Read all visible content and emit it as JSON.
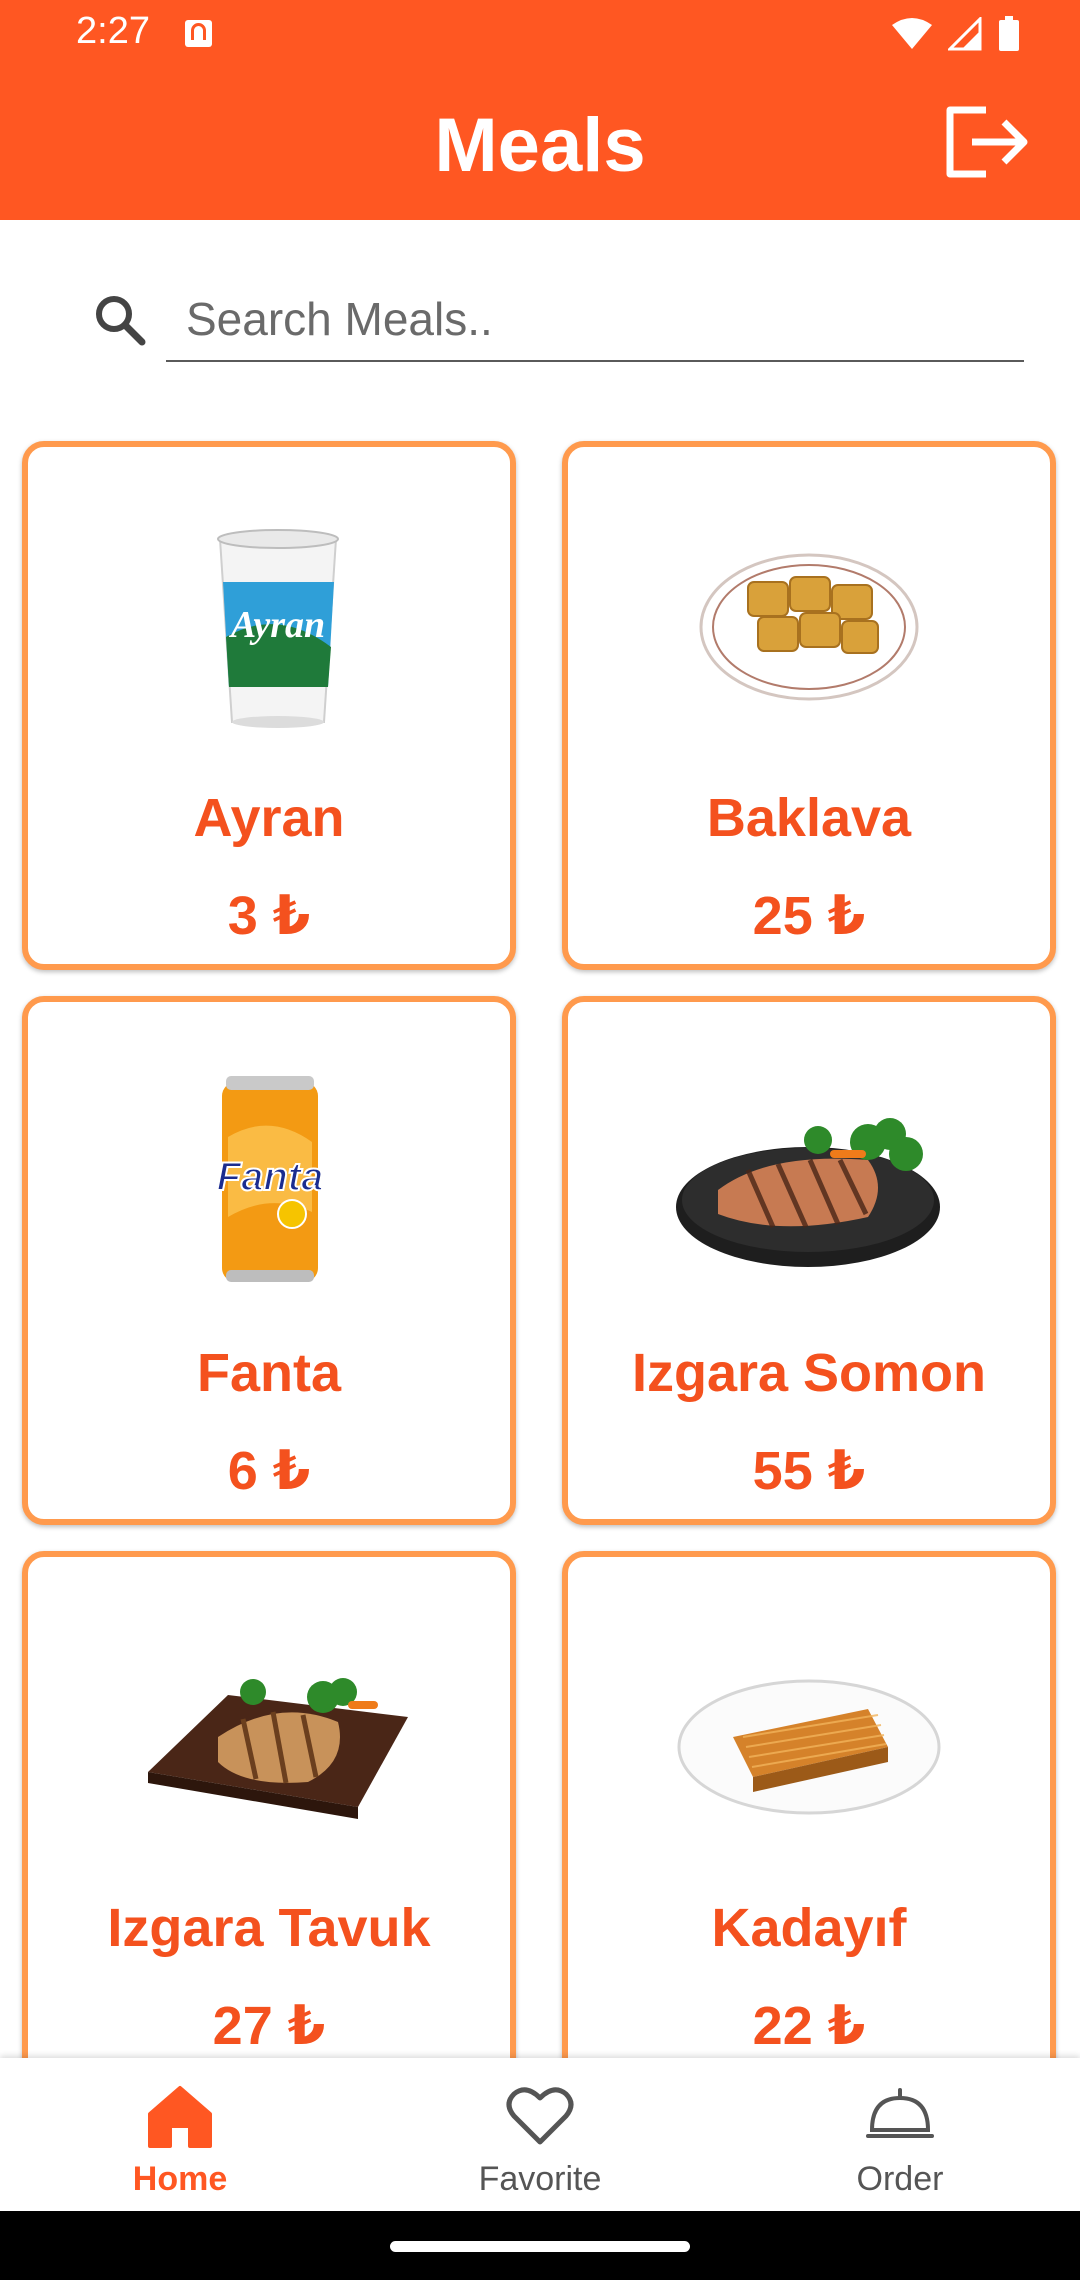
{
  "status_bar": {
    "time": "2:27"
  },
  "app_bar": {
    "title": "Meals",
    "logout_icon": "logout-icon"
  },
  "search": {
    "placeholder": "Search Meals..",
    "value": ""
  },
  "meals": [
    {
      "name": "Ayran",
      "price": "3 ₺",
      "image": "ayran-cup-image"
    },
    {
      "name": "Baklava",
      "price": "25 ₺",
      "image": "baklava-plate-image"
    },
    {
      "name": "Fanta",
      "price": "6 ₺",
      "image": "fanta-can-image"
    },
    {
      "name": "Izgara Somon",
      "price": "55 ₺",
      "image": "grilled-salmon-image"
    },
    {
      "name": "Izgara Tavuk",
      "price": "27 ₺",
      "image": "grilled-chicken-image"
    },
    {
      "name": "Kadayıf",
      "price": "22 ₺",
      "image": "kadayif-plate-image"
    }
  ],
  "bottom_nav": {
    "items": [
      {
        "label": "Home",
        "icon": "home-icon",
        "active": true
      },
      {
        "label": "Favorite",
        "icon": "heart-icon",
        "active": false
      },
      {
        "label": "Order",
        "icon": "cloche-icon",
        "active": false
      }
    ]
  },
  "colors": {
    "primary": "#FF5722",
    "card_border": "#FF9A4D",
    "text_accent": "#F4511E"
  }
}
